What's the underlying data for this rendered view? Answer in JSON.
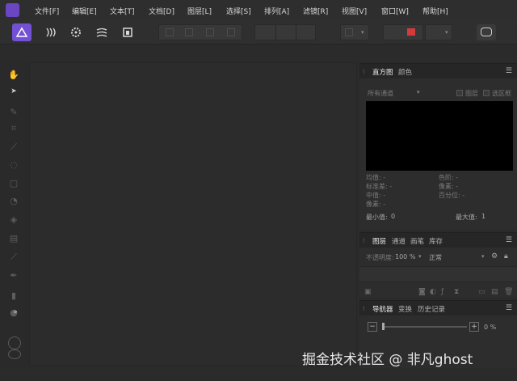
{
  "menubar": {
    "items": [
      "文件[F]",
      "编辑[E]",
      "文本[T]",
      "文档[D]",
      "图层[L]",
      "选择[S]",
      "排列[A]",
      "滤镜[R]",
      "视图[V]",
      "窗口[W]",
      "帮助[H]"
    ]
  },
  "toolbar": {
    "personas": [
      "photo-persona-icon",
      "liquify-persona-icon",
      "develop-persona-icon",
      "tone-mapping-persona-icon",
      "export-persona-icon"
    ]
  },
  "colors": {
    "accent": "#6a46c2",
    "persona_active": "#7251d4",
    "record_red": "#d23b3b",
    "histogram_bg": "#000000"
  },
  "histogram_panel": {
    "tabs": [
      "直方图",
      "颜色"
    ],
    "channel": "所有通道",
    "checkbox_layer": "图层",
    "checkbox_selection": "选区框",
    "stats_left": [
      "均值: -",
      "标准差: -",
      "中值: -",
      "像素: -"
    ],
    "stats_right": [
      "色阶: -",
      "像素: -",
      "百分位: -"
    ],
    "min_label": "最小值:",
    "min_value": "0",
    "max_label": "最大值:",
    "max_value": "1"
  },
  "layers_panel": {
    "tabs": [
      "图层",
      "通道",
      "画笔",
      "库存"
    ],
    "opacity_label": "不透明度:",
    "opacity_value": "100 %",
    "blend_mode": "正常"
  },
  "navigator_panel": {
    "tabs": [
      "导航器",
      "变换",
      "历史记录"
    ],
    "minus": "−",
    "plus": "+",
    "zoom": "0 %"
  },
  "watermark": "掘金技术社区 @ 非凡ghost"
}
